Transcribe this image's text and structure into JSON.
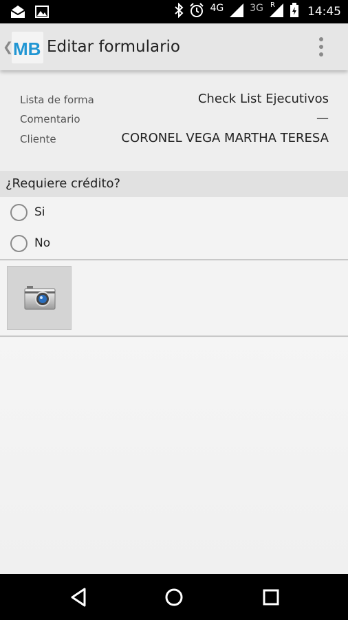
{
  "status_bar": {
    "icons": [
      "mail-icon",
      "image-icon",
      "bluetooth-icon",
      "alarm-icon",
      "signal-icon",
      "signal-icon",
      "battery-icon"
    ],
    "network_primary": "4G",
    "network_secondary": "3G",
    "roaming": "R",
    "time": "14:45"
  },
  "action_bar": {
    "logo": "MB",
    "title": "Editar formulario"
  },
  "info": {
    "rows": [
      {
        "label": "Lista de forma",
        "value": "Check List Ejecutivos"
      },
      {
        "label": "Comentario",
        "value": "—"
      },
      {
        "label": "Cliente",
        "value": "CORONEL VEGA MARTHA TERESA"
      }
    ]
  },
  "question": {
    "text": "¿Requiere crédito?",
    "options": [
      "Si",
      "No"
    ],
    "selected": null
  },
  "colors": {
    "logo_blue": "#2196d3",
    "status_bar": "#000000",
    "action_bar": "#e6e6e6"
  }
}
